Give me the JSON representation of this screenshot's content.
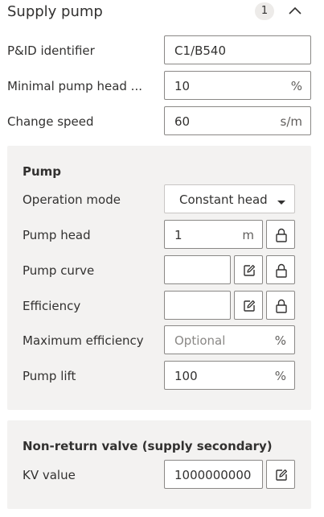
{
  "header": {
    "title": "Supply pump",
    "badge": "1"
  },
  "fields": {
    "pid_label": "P&ID identifier",
    "pid_value": "C1/B540",
    "min_head_label": "Minimal pump head ...",
    "min_head_value": "10",
    "min_head_unit": "%",
    "speed_label": "Change speed",
    "speed_value": "60",
    "speed_unit": "s/m"
  },
  "pump": {
    "title": "Pump",
    "operation_mode_label": "Operation mode",
    "operation_mode_value": "Constant head",
    "pump_head_label": "Pump head",
    "pump_head_value": "1",
    "pump_head_unit": "m",
    "pump_curve_label": "Pump curve",
    "efficiency_label": "Efficiency",
    "max_eff_label": "Maximum efficiency",
    "max_eff_placeholder": "Optional",
    "max_eff_unit": "%",
    "pump_lift_label": "Pump lift",
    "pump_lift_value": "100",
    "pump_lift_unit": "%"
  },
  "valve": {
    "title": "Non-return valve (supply secondary)",
    "kv_label": "KV value",
    "kv_value": "1000000000"
  },
  "icons": {
    "collapse": "chevron-up-icon",
    "lock": "lock-icon",
    "edit": "edit-icon",
    "dropdown": "caret-down-icon"
  }
}
